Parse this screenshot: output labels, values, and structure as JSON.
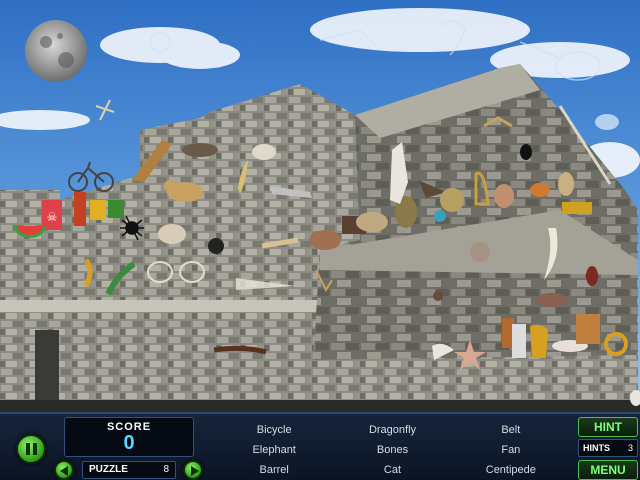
{
  "hud": {
    "score_label": "SCORE",
    "score_value": "0",
    "puzzle_label": "PUZZLE",
    "puzzle_number": "8",
    "hint_label": "HINT",
    "hints_label": "HINTS",
    "hints_remaining": "3",
    "menu_label": "MENU"
  },
  "find_list": [
    "Bicycle",
    "Dragonfly",
    "Belt",
    "Elephant",
    "Bones",
    "Fan",
    "Barrel",
    "Cat",
    "Centipede"
  ],
  "icons": {
    "pause": "pause-icon",
    "prev": "previous-arrow-icon",
    "next": "next-arrow-icon"
  },
  "colors": {
    "sky": "#3b7fd0",
    "stone": "#9a9a92",
    "hud_bg": "#0f1a2e",
    "button_green": "#4cc04c",
    "score_blue": "#5fd0ff"
  }
}
